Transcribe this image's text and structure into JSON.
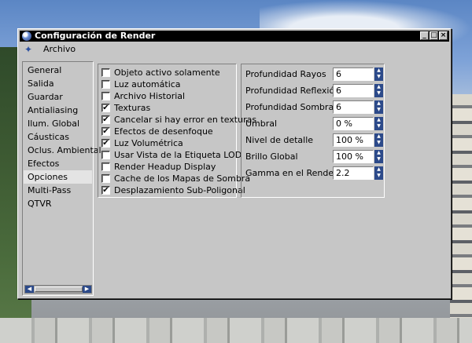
{
  "window": {
    "title": "Configuración de Render",
    "controls": {
      "minimize": "_",
      "maximize": "□",
      "close": "×"
    }
  },
  "menu": {
    "file": "Archivo"
  },
  "sidebar": {
    "items": [
      {
        "label": "General"
      },
      {
        "label": "Salida"
      },
      {
        "label": "Guardar"
      },
      {
        "label": "Antialiasing"
      },
      {
        "label": "Ilum. Global"
      },
      {
        "label": "Cáusticas"
      },
      {
        "label": "Oclus. Ambiental"
      },
      {
        "label": "Efectos"
      },
      {
        "label": "Opciones",
        "selected": true
      },
      {
        "label": "Multi-Pass"
      },
      {
        "label": "QTVR"
      }
    ]
  },
  "options": [
    {
      "label": "Objeto activo solamente",
      "checked": false
    },
    {
      "label": "Luz automática",
      "checked": false
    },
    {
      "label": "Archivo Historial",
      "checked": false
    },
    {
      "label": "Texturas",
      "checked": true
    },
    {
      "label": "Cancelar si hay error en texturas",
      "checked": true
    },
    {
      "label": "Efectos de desenfoque",
      "checked": true
    },
    {
      "label": "Luz Volumétrica",
      "checked": true
    },
    {
      "label": "Usar Vista de la Etiqueta LOD",
      "checked": false
    },
    {
      "label": "Render Headup Display",
      "checked": false
    },
    {
      "label": "Cache de los Mapas de Sombra",
      "checked": false
    },
    {
      "label": "Desplazamiento Sub-Poligonal",
      "checked": true
    }
  ],
  "params": [
    {
      "label": "Profundidad Rayos",
      "value": "6"
    },
    {
      "label": "Profundidad Reflexión",
      "value": "6"
    },
    {
      "label": "Profundidad Sombras",
      "value": "6"
    },
    {
      "label": "Umbral",
      "value": "0 %"
    },
    {
      "label": "Nivel de detalle",
      "value": "100 %"
    },
    {
      "label": "Brillo Global",
      "value": "100 %"
    },
    {
      "label": "Gamma en el Render",
      "value": "2.2"
    }
  ],
  "icons": {
    "app": "cinema4d-sphere-icon",
    "menu": "pin-icon",
    "scroll_left": "◀",
    "scroll_right": "▶",
    "spin_up": "▲",
    "spin_down": "▼",
    "check": "✔"
  }
}
